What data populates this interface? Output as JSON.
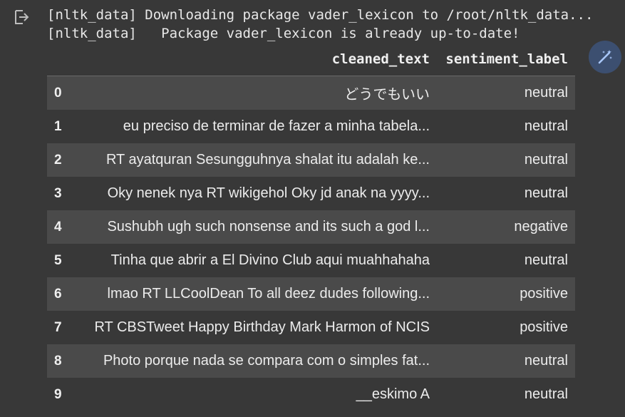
{
  "output": {
    "icon": "output-redirect-icon",
    "lines": [
      "[nltk_data] Downloading package vader_lexicon to /root/nltk_data...",
      "[nltk_data]   Package vader_lexicon is already up-to-date!"
    ]
  },
  "magic_button": {
    "icon": "magic-wand-icon",
    "accent": "#3c4f70"
  },
  "table": {
    "columns": [
      "",
      "cleaned_text",
      "sentiment_label"
    ],
    "rows": [
      {
        "index": "0",
        "cleaned_text": "どうでもいい",
        "sentiment_label": "neutral"
      },
      {
        "index": "1",
        "cleaned_text": "eu preciso de terminar de fazer a minha tabela...",
        "sentiment_label": "neutral"
      },
      {
        "index": "2",
        "cleaned_text": "RT ayatquran Sesungguhnya shalat itu adalah ke...",
        "sentiment_label": "neutral"
      },
      {
        "index": "3",
        "cleaned_text": "Oky nenek nya RT wikigehol Oky jd anak na yyyy...",
        "sentiment_label": "neutral"
      },
      {
        "index": "4",
        "cleaned_text": "Sushubh ugh such nonsense and its such a god l...",
        "sentiment_label": "negative"
      },
      {
        "index": "5",
        "cleaned_text": "Tinha que abrir a El Divino Club aqui muahhahaha",
        "sentiment_label": "neutral"
      },
      {
        "index": "6",
        "cleaned_text": "lmao RT LLCoolDean To all deez dudes following...",
        "sentiment_label": "positive"
      },
      {
        "index": "7",
        "cleaned_text": "RT CBSTweet Happy Birthday Mark Harmon of NCIS",
        "sentiment_label": "positive"
      },
      {
        "index": "8",
        "cleaned_text": "Photo porque nada se compara com o simples fat...",
        "sentiment_label": "neutral"
      },
      {
        "index": "9",
        "cleaned_text": "__eskimo A",
        "sentiment_label": "neutral"
      }
    ]
  },
  "colors": {
    "background": "#383838",
    "row_striped": "#4a4a4a",
    "text": "#ececec"
  }
}
